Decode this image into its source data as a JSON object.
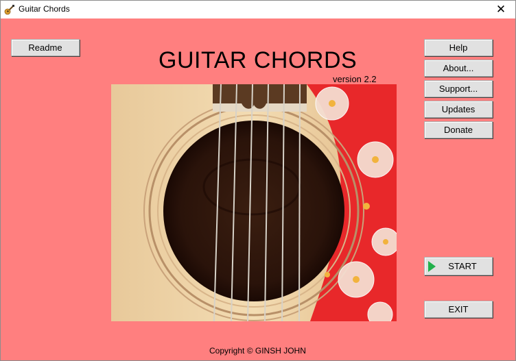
{
  "window": {
    "title": "Guitar Chords",
    "close_glyph": "✕",
    "icon": "guitar-icon"
  },
  "buttons": {
    "readme": "Readme",
    "help": "Help",
    "about": "About...",
    "support": "Support...",
    "updates": "Updates",
    "donate": "Donate",
    "start": "START",
    "exit": "EXIT"
  },
  "main": {
    "heading": "GUITAR CHORDS",
    "version": "version 2.2",
    "image": "acoustic-guitar-soundhole-photo",
    "copyright": "Copyright © GINSH JOHN"
  },
  "colors": {
    "background": "#ff7f7f",
    "button_face": "#e1e1e1",
    "start_arrow": "#22b14c",
    "pickguard": "#e8282a"
  }
}
